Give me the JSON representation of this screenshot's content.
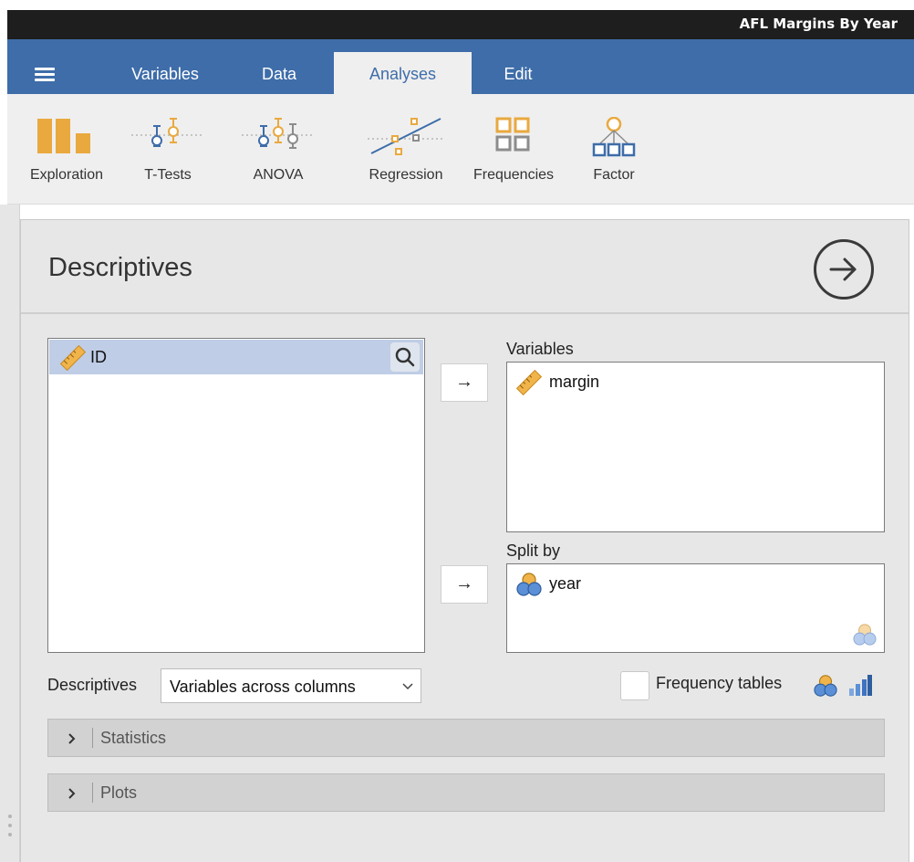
{
  "window": {
    "title": "AFL Margins By Year"
  },
  "tabs": [
    {
      "label": "Variables",
      "active": false
    },
    {
      "label": "Data",
      "active": false
    },
    {
      "label": "Analyses",
      "active": true
    },
    {
      "label": "Edit",
      "active": false
    }
  ],
  "ribbon": {
    "buttons": [
      {
        "label": "Exploration",
        "icon": "exploration-bars-icon"
      },
      {
        "label": "T-Tests",
        "icon": "ttests-icon"
      },
      {
        "label": "ANOVA",
        "icon": "anova-icon"
      },
      {
        "label": "Regression",
        "icon": "regression-icon"
      },
      {
        "label": "Frequencies",
        "icon": "frequencies-grid-icon"
      },
      {
        "label": "Factor",
        "icon": "factor-tree-icon"
      }
    ]
  },
  "analysis": {
    "title": "Descriptives",
    "available_variables": [
      {
        "name": "ID",
        "type": "continuous",
        "icon": "ruler-icon",
        "selected": true
      }
    ],
    "variables_box": {
      "label": "Variables",
      "items": [
        {
          "name": "margin",
          "type": "continuous",
          "icon": "ruler-icon"
        }
      ]
    },
    "split_by_box": {
      "label": "Split by",
      "items": [
        {
          "name": "year",
          "type": "nominal",
          "icon": "nominal-circles-icon"
        }
      ]
    },
    "move_arrow": "→",
    "descriptives_option": {
      "label": "Descriptives",
      "value": "Variables across columns"
    },
    "frequency_tables": {
      "label": "Frequency tables",
      "checked": false
    },
    "sections": [
      {
        "label": "Statistics",
        "expanded": false
      },
      {
        "label": "Plots",
        "expanded": false
      }
    ]
  },
  "colors": {
    "accent_blue": "#3e6da9",
    "icon_orange": "#e9a93f",
    "icon_gray": "#8c8c8c",
    "selection": "#bfcde6"
  }
}
